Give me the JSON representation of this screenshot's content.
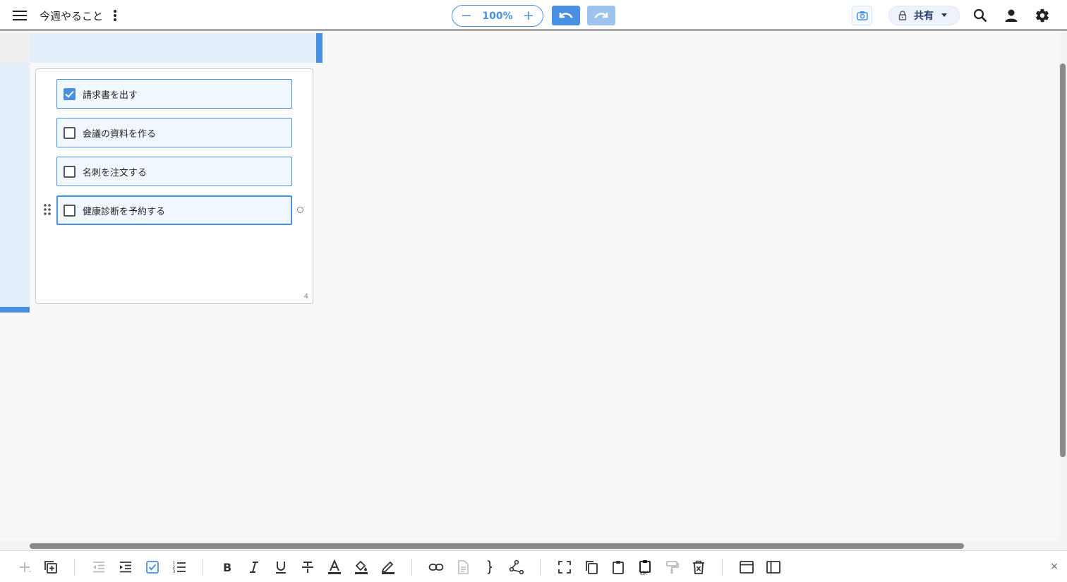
{
  "header": {
    "title": "今週やること",
    "zoom": {
      "value": "100%",
      "minus": "−",
      "plus": "+"
    },
    "share_label": "共有"
  },
  "card": {
    "count": "4",
    "tasks": [
      {
        "label": "請求書を出す",
        "checked": true
      },
      {
        "label": "会議の資料を作る",
        "checked": false
      },
      {
        "label": "名刺を注文する",
        "checked": false
      },
      {
        "label": "健康診断を予約する",
        "checked": false
      }
    ]
  },
  "toolbar": {
    "close": "×",
    "icons": [
      "add-icon",
      "duplicate-icon",
      "outdent-icon",
      "indent-icon",
      "checklist-icon",
      "numbered-list-icon",
      "bold-icon",
      "italic-icon",
      "underline-icon",
      "strikethrough-icon",
      "text-color-icon",
      "fill-color-icon",
      "highlight-icon",
      "link-icon",
      "note-icon",
      "brace-icon",
      "connect-icon",
      "fit-screen-icon",
      "copy-icon",
      "paste-icon",
      "paste-text-icon",
      "format-painter-icon",
      "delete-icon",
      "window-icon",
      "sidebar-icon"
    ]
  },
  "colors": {
    "accent": "#4a90e2",
    "accent_light": "#e3effb",
    "redo_disabled": "#9cc2ee"
  }
}
